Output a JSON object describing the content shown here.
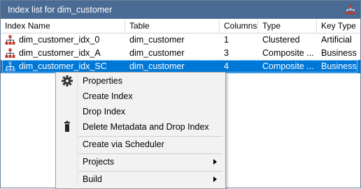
{
  "window": {
    "title": "Index list for dim_customer",
    "title_icon": "index-hierarchy-icon",
    "colors": {
      "titlebar": "#4a6b94",
      "selection": "#0078d7",
      "icon_red": "#c0392b"
    }
  },
  "grid": {
    "columns": [
      "Index Name",
      "Table",
      "Columns",
      "Type",
      "Key Type"
    ],
    "rows": [
      {
        "name": "dim_customer_idx_0",
        "table": "dim_customer",
        "columns": "1",
        "type": "Clustered",
        "key_type": "Artificial",
        "icon": "index-red-icon",
        "selected": false
      },
      {
        "name": "dim_customer_idx_A",
        "table": "dim_customer",
        "columns": "3",
        "type": "Composite ...",
        "key_type": "Business",
        "icon": "index-red-icon",
        "selected": false
      },
      {
        "name": "dim_customer_idx_SC",
        "table": "dim_customer",
        "columns": "4",
        "type": "Composite ...",
        "key_type": "Business",
        "icon": "index-blue-icon",
        "selected": true
      }
    ]
  },
  "context_menu": {
    "items": [
      {
        "label": "Properties",
        "icon": "gear-icon",
        "submenu": false
      },
      {
        "label": "Create Index",
        "icon": "",
        "submenu": false
      },
      {
        "label": "Drop Index",
        "icon": "",
        "submenu": false
      },
      {
        "label": "Delete Metadata and Drop Index",
        "icon": "trash-icon",
        "submenu": false
      },
      {
        "label": "Create via Scheduler",
        "icon": "",
        "submenu": false
      },
      {
        "label": "Projects",
        "icon": "",
        "submenu": true
      },
      {
        "label": "Build",
        "icon": "",
        "submenu": true
      }
    ]
  }
}
